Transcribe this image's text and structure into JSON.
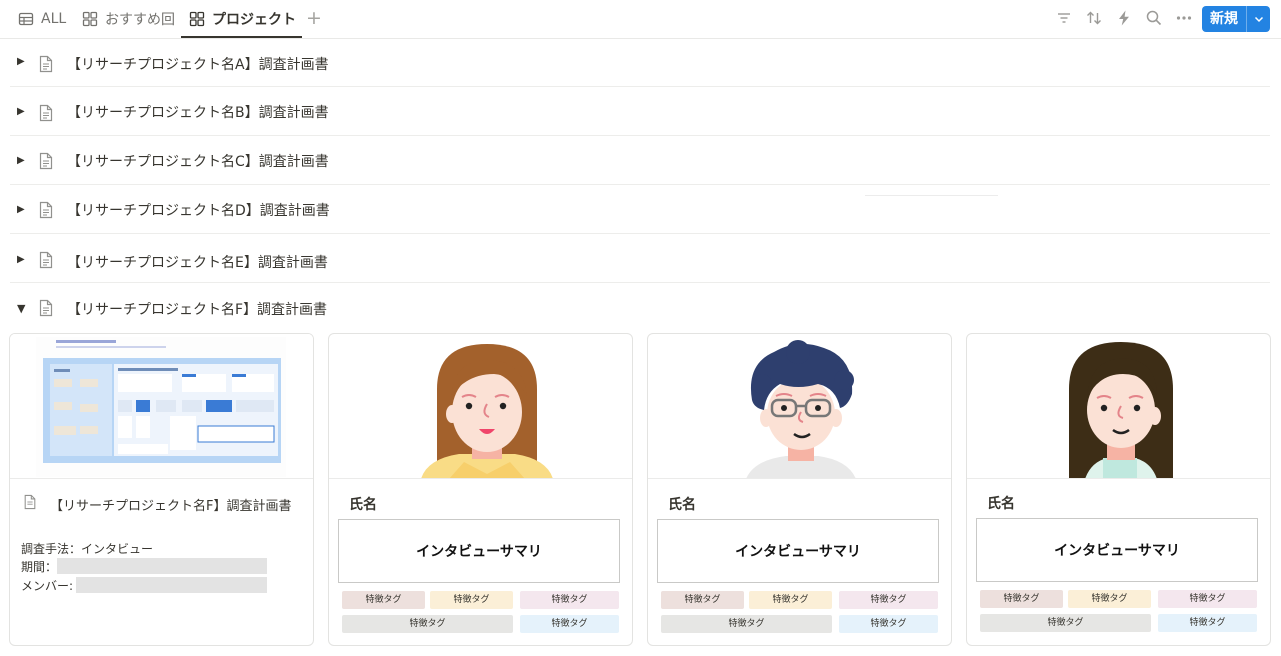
{
  "tabs": [
    {
      "label": "ALL",
      "icon": "table-icon",
      "active": false
    },
    {
      "label": "おすすめ回",
      "icon": "gallery-icon",
      "active": false
    },
    {
      "label": "プロジェクト",
      "icon": "gallery-icon",
      "active": true
    }
  ],
  "toolbar": {
    "new_label": "新規",
    "icons": [
      "filter-icon",
      "sort-icon",
      "lightning-icon",
      "search-icon",
      "more-icon"
    ],
    "accent": "#2383e2"
  },
  "rows": [
    {
      "title": "【リサーチプロジェクト名A】調査計画書",
      "expanded": false
    },
    {
      "title": "【リサーチプロジェクト名B】調査計画書",
      "expanded": false
    },
    {
      "title": "【リサーチプロジェクト名C】調査計画書",
      "expanded": false
    },
    {
      "title": "【リサーチプロジェクト名D】調査計画書",
      "expanded": false
    },
    {
      "title": "【リサーチプロジェクト名E】調査計画書",
      "expanded": false
    },
    {
      "title": "【リサーチプロジェクト名F】調査計画書",
      "expanded": true
    }
  ],
  "project_card": {
    "title": "【リサーチプロジェクト名F】調査計画書",
    "method": "調査手法：インタビュー",
    "period_label": "期間：",
    "member_label": "メンバー:"
  },
  "person_cards": [
    {
      "name": "氏名",
      "summary": "インタビューサマリ",
      "avatar": "woman-brown-hair-avatar",
      "tags": [
        "特徴タグ",
        "特徴タグ",
        "特徴タグ",
        "特徴タグ",
        "特徴タグ"
      ]
    },
    {
      "name": "氏名",
      "summary": "インタビューサマリ",
      "avatar": "man-glasses-avatar",
      "tags": [
        "特徴タグ",
        "特徴タグ",
        "特徴タグ",
        "特徴タグ",
        "特徴タグ"
      ]
    },
    {
      "name": "氏名",
      "summary": "インタビューサマリ",
      "avatar": "woman-dark-hair-avatar",
      "tags": [
        "特徴タグ",
        "特徴タグ",
        "特徴タグ",
        "特徴タグ",
        "特徴タグ"
      ]
    }
  ],
  "tag_colors": [
    "#ede0dd",
    "#fbefd7",
    "#f4e7ee",
    "#e6e6e4",
    "#e5f2fb"
  ]
}
